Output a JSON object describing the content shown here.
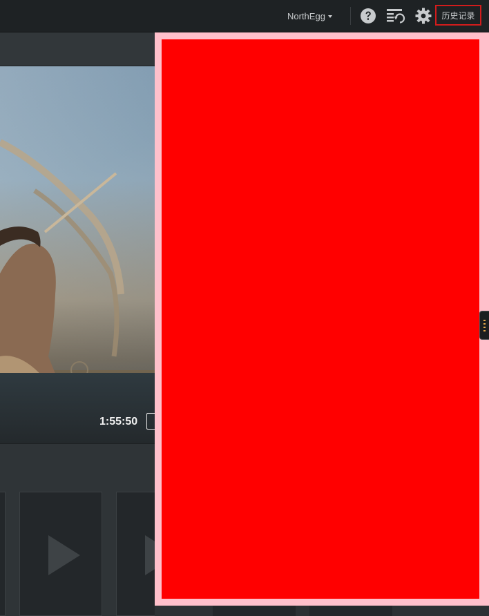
{
  "header": {
    "user_menu_label": "NorthEgg",
    "icons": [
      "help-icon",
      "playlist-refresh-icon",
      "gear-icon"
    ],
    "history_label": "历史记录",
    "history_highlight_color": "#d31c1c"
  },
  "hero": {
    "duration": "1:55:50"
  },
  "overlay": {
    "border_color": "#ffc0cb",
    "fill_color": "#ff0000"
  },
  "thumbnails": {
    "icons": [
      "play-icon",
      "play-icon"
    ]
  }
}
